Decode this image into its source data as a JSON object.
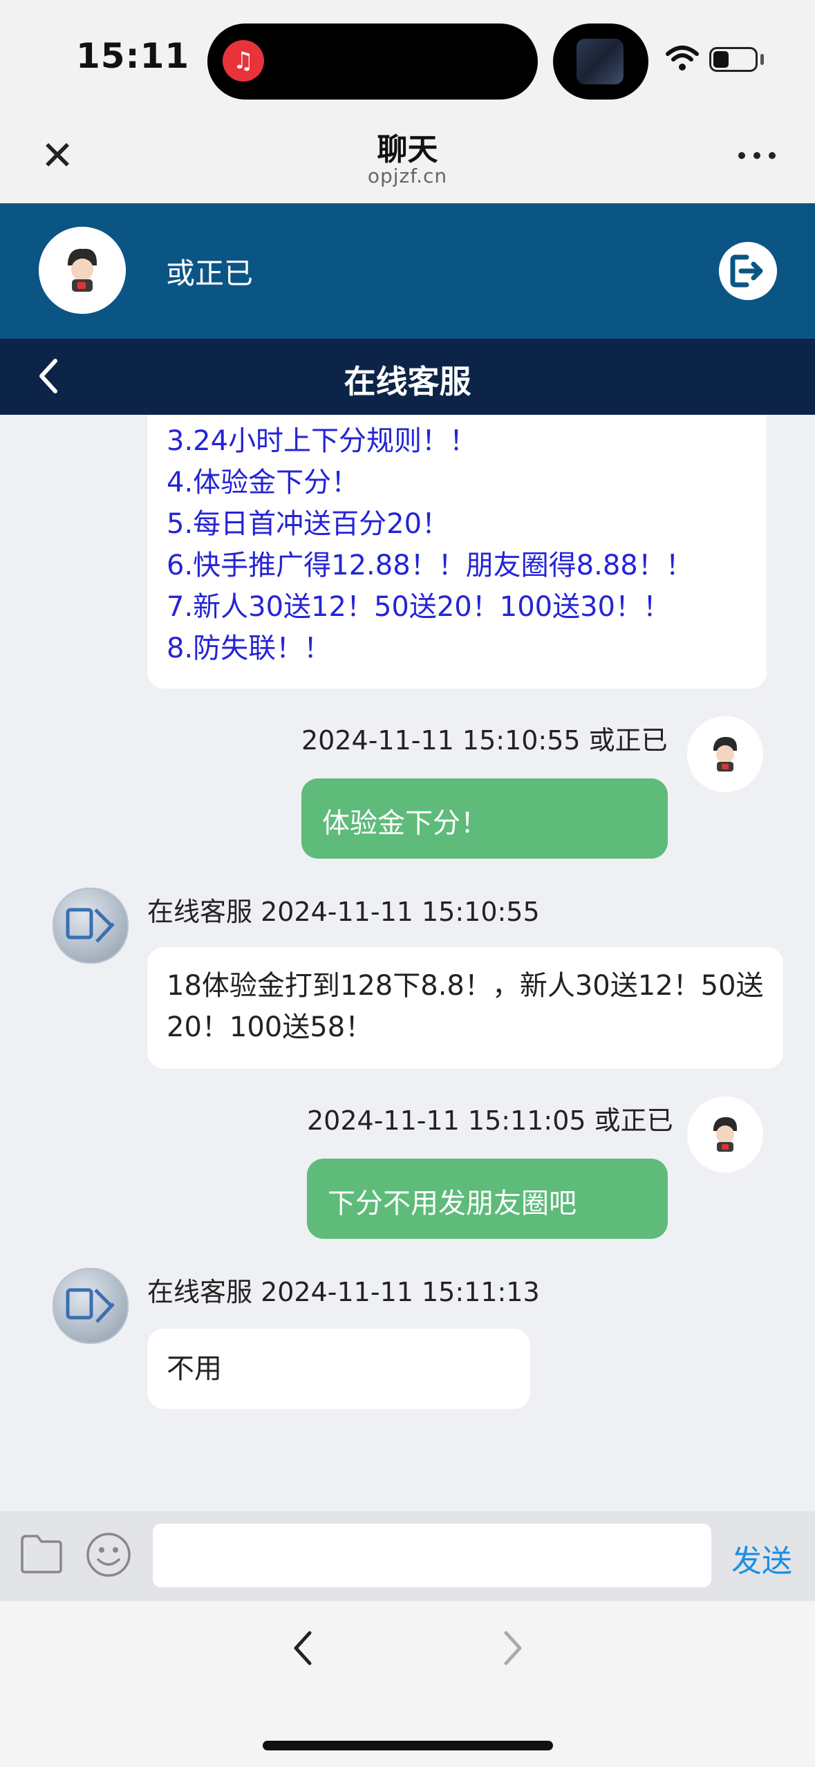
{
  "status": {
    "time": "15:11",
    "island_app_glyph": "♫"
  },
  "nav": {
    "close": "✕",
    "title": "聊天",
    "subtitle": "opjzf.cn"
  },
  "user": {
    "name": "或正已"
  },
  "header": {
    "title": "在线客服"
  },
  "messages": {
    "m0_lines": [
      "3.24小时上下分规则！！",
      "4.体验金下分！",
      "5.每日首冲送百分20！",
      "6.快手推广得12.88！！朋友圈得8.88！！",
      "7.新人30送12！50送20！100送30！！",
      "8.防失联！！"
    ],
    "m1": {
      "meta": "2024-11-11 15:10:55 或正已",
      "text": "体验金下分！"
    },
    "m2": {
      "meta": "在线客服 2024-11-11 15:10:55",
      "text": "18体验金打到128下8.8！，新人30送12！50送20！100送58！"
    },
    "m3": {
      "meta": "2024-11-11 15:11:05 或正已",
      "text": "下分不用发朋友圈吧"
    },
    "m4": {
      "meta": "在线客服 2024-11-11 15:11:13",
      "text": "不用"
    }
  },
  "composer": {
    "placeholder": "",
    "send_label": "发送"
  },
  "browser": {
    "back": "‹",
    "forward": "›"
  },
  "colors": {
    "header_blue": "#0b5585",
    "header_navy": "#0d2449",
    "bubble_green": "#5ebb7a",
    "link_blue": "#2424d6",
    "send_blue": "#1e8ee0"
  }
}
